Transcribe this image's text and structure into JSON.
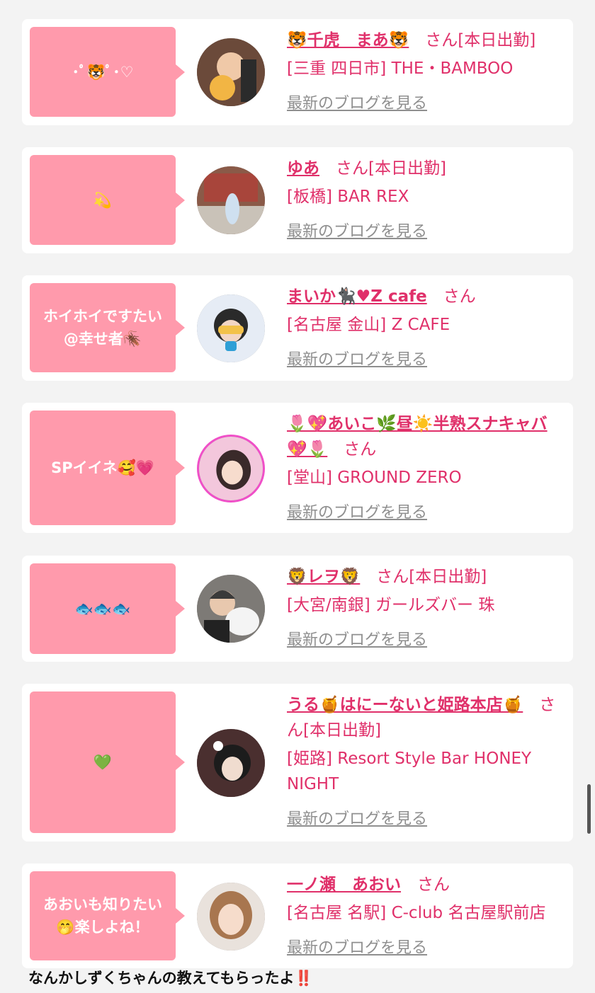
{
  "entries": [
    {
      "bubble": "･ﾟ🐯ﾟ･♡",
      "name": "🐯千虎　まあ🐯",
      "suffix": "さん[本日出勤]",
      "shop": "[三重 四日市] THE・BAMBOO",
      "blog": "最新のブログを見る",
      "avatar_color": "#6b4a3a"
    },
    {
      "bubble": "💫",
      "name": "ゆあ",
      "suffix": "さん[本日出勤]",
      "shop": "[板橋] BAR REX",
      "blog": "最新のブログを見る",
      "avatar_color": "#8a5a48"
    },
    {
      "bubble": "ホイホイですたい\n@幸せ者🪳",
      "name": "まいか🐈‍⬛♥Z cafe",
      "suffix": "さん",
      "shop": "[名古屋 金山] Z CAFE",
      "blog": "最新のブログを見る",
      "avatar_color": "#cfd8e8"
    },
    {
      "bubble": "SPイイネ🥰💗",
      "name": "🌷💖あいこ🌿昼☀️半熟スナキャバ💖🌷",
      "suffix": "さん",
      "shop": "[堂山] GROUND ZERO",
      "blog": "最新のブログを見る",
      "avatar_color": "#f3c7dc"
    },
    {
      "bubble": "🐟🐟🐟",
      "name": "🦁レヲ🦁",
      "suffix": "さん[本日出勤]",
      "shop": "[大宮/南銀] ガールズバー 珠",
      "blog": "最新のブログを見る",
      "avatar_color": "#5c5a5a"
    },
    {
      "bubble": "💚",
      "name": "うる🍯はにーないと姫路本店🍯",
      "suffix": "さん[本日出勤]",
      "shop": "[姫路] Resort Style Bar HONEY NIGHT",
      "blog": "最新のブログを見る",
      "avatar_color": "#4a2f2f"
    },
    {
      "bubble": "あおいも知りたい\n🤭楽しよね！",
      "name": "一ノ瀬　あおい",
      "suffix": "さん",
      "shop": "[名古屋 名駅] C-club 名古屋駅前店",
      "blog": "最新のブログを見る",
      "avatar_color": "#d8b49a"
    }
  ],
  "footer_text": "なんかしずくちゃんの教えてもらったよ‼️",
  "colors": {
    "accent": "#e0306a",
    "bubble": "#ff9aac",
    "link": "#8f8f8f"
  }
}
